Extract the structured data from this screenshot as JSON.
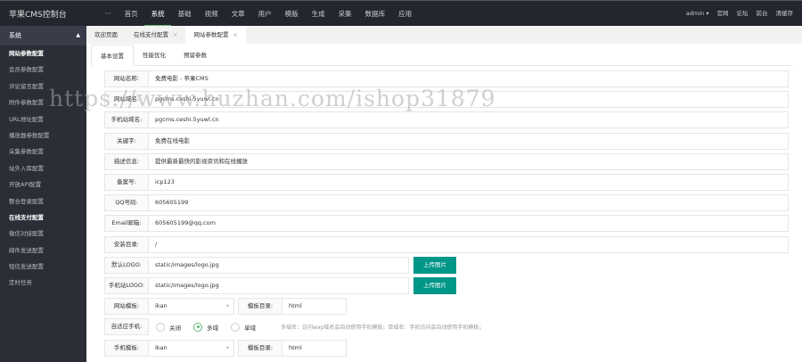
{
  "app_title": "苹果CMS控制台",
  "nav": [
    "···",
    "首页",
    "系统",
    "基础",
    "视频",
    "文章",
    "用户",
    "模版",
    "生成",
    "采集",
    "数据库",
    "应用"
  ],
  "nav_active": 2,
  "user": {
    "name": "admin ▾",
    "links": [
      "官网",
      "论坛",
      "前台",
      "清缓存"
    ]
  },
  "sidebar": {
    "header": "系统",
    "items": [
      "网站参数配置",
      "会员参数配置",
      "评论留言配置",
      "附件参数配置",
      "URL地址配置",
      "播放器参数配置",
      "采集参数配置",
      "站外入库配置",
      "开放API配置",
      "整合登录配置",
      "在线支付配置",
      "微信对接配置",
      "邮件发送配置",
      "短信发送配置",
      "定时任务"
    ]
  },
  "tabs": [
    {
      "label": "欢迎页面"
    },
    {
      "label": "在线支付配置",
      "close": "×"
    },
    {
      "label": "网站参数配置",
      "close": "×"
    }
  ],
  "subtabs": [
    "基本设置",
    "性能优化",
    "预留参数"
  ],
  "fields": [
    {
      "label": "网站名称:",
      "value": "免费电影 - 苹果CMS"
    },
    {
      "label": "网站域名:",
      "value": "pgcms.ceshi.5yuwl.cn"
    },
    {
      "label": "手机站域名:",
      "value": "pgcms.ceshi.5yuwl.cn"
    },
    {
      "label": "关键字:",
      "value": "免费在线电影"
    },
    {
      "label": "描述信息:",
      "value": "提供最新最快的影视资讯和在线播放"
    },
    {
      "label": "备案号:",
      "value": "icp123"
    },
    {
      "label": "QQ号码:",
      "value": "605605199"
    },
    {
      "label": "Email邮箱:",
      "value": "605605199@qq.com"
    },
    {
      "label": "安装目录:",
      "value": "/"
    }
  ],
  "logos": [
    {
      "label": "默认LOGO:",
      "value": "static/images/logo.jpg",
      "button": "上传图片"
    },
    {
      "label": "手机站LOGO:",
      "value": "static/images/logo.jpg",
      "button": "上传图片"
    }
  ],
  "template": {
    "label": "网站模板:",
    "value": "ikan",
    "dir_label": "模板目录:",
    "dir_value": "html"
  },
  "mobile_adapt": {
    "label": "自适应手机:",
    "options": [
      "关闭",
      "多域",
      "单域"
    ],
    "selected": 1,
    "tip": "多域名：访问wap域名会自动使用手机模板；单域名：手机访问会自动使用手机模板；"
  },
  "mobile_template": {
    "label": "手机模板:",
    "value": "ikan",
    "dir_label": "模板目录:",
    "dir_value": "html"
  },
  "watermark": "https://www.huzhan.com/ishop31879"
}
